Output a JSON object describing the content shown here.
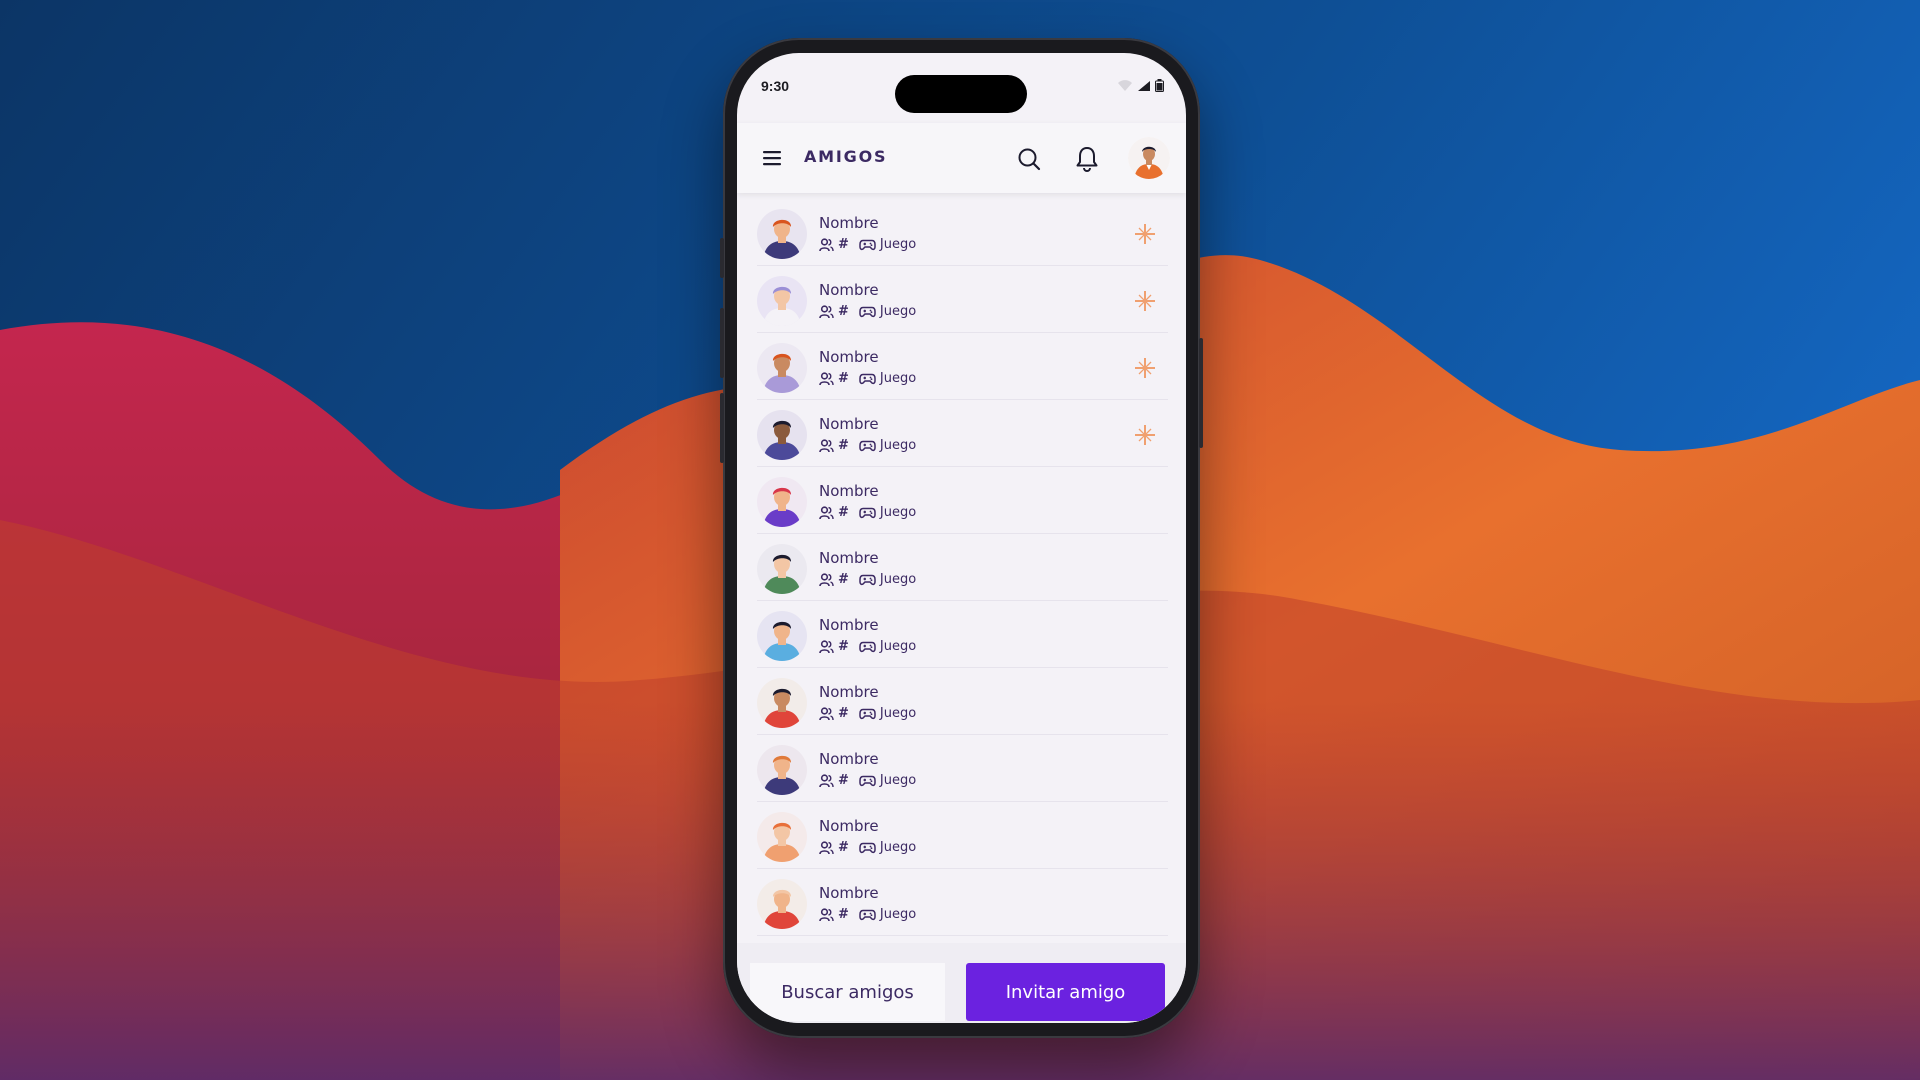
{
  "status_bar": {
    "time": "9:30"
  },
  "app_bar": {
    "title": "AMIGOS"
  },
  "friends": [
    {
      "name": "Nombre",
      "hash": "#",
      "game": "Juego",
      "favorite": true,
      "skin": "#f0b48a",
      "hair": "#d9541e",
      "shirt": "#3d3a7a",
      "bg": "#e8e4f0"
    },
    {
      "name": "Nombre",
      "hash": "#",
      "game": "Juego",
      "favorite": true,
      "skin": "#f3c6a5",
      "hair": "#9b8fd6",
      "shirt": "#f4f2f7",
      "bg": "#e9e4f4"
    },
    {
      "name": "Nombre",
      "hash": "#",
      "game": "Juego",
      "favorite": true,
      "skin": "#c98a61",
      "hair": "#d9541e",
      "shirt": "#a99ad8",
      "bg": "#ece8f2"
    },
    {
      "name": "Nombre",
      "hash": "#",
      "game": "Juego",
      "favorite": true,
      "skin": "#8b5a3c",
      "hair": "#1c1b2e",
      "shirt": "#4c4a9a",
      "bg": "#e6e2ef"
    },
    {
      "name": "Nombre",
      "hash": "#",
      "game": "Juego",
      "favorite": false,
      "skin": "#f0b48a",
      "hair": "#d8364a",
      "shirt": "#6a3cc8",
      "bg": "#f0e8f2"
    },
    {
      "name": "Nombre",
      "hash": "#",
      "game": "Juego",
      "favorite": false,
      "skin": "#f3c6a5",
      "hair": "#1c1b2e",
      "shirt": "#4f8a5a",
      "bg": "#ebe9f0"
    },
    {
      "name": "Nombre",
      "hash": "#",
      "game": "Juego",
      "favorite": false,
      "skin": "#f0b48a",
      "hair": "#1c1b2e",
      "shirt": "#5aaee0",
      "bg": "#e6e4f2"
    },
    {
      "name": "Nombre",
      "hash": "#",
      "game": "Juego",
      "favorite": false,
      "skin": "#c98a61",
      "hair": "#1c1b2e",
      "shirt": "#e0453a",
      "bg": "#f2ece9"
    },
    {
      "name": "Nombre",
      "hash": "#",
      "game": "Juego",
      "favorite": false,
      "skin": "#f0b48a",
      "hair": "#e07a3a",
      "shirt": "#3d3a7a",
      "bg": "#ede7ee"
    },
    {
      "name": "Nombre",
      "hash": "#",
      "game": "Juego",
      "favorite": false,
      "skin": "#f3c6a5",
      "hair": "#e8703a",
      "shirt": "#f0a070",
      "bg": "#f4eaea"
    },
    {
      "name": "Nombre",
      "hash": "#",
      "game": "Juego",
      "favorite": false,
      "skin": "#f0b48a",
      "hair": "#f3c6a5",
      "shirt": "#e0453a",
      "bg": "#f3ece8"
    }
  ],
  "actions": {
    "search_label": "Buscar amigos",
    "invite_label": "Invitar amigo"
  },
  "colors": {
    "accent": "#6b22e0",
    "text": "#3c2a63",
    "favorite": "#f0a070"
  },
  "icons": {
    "menu": "hamburger-menu-icon",
    "search": "search-icon",
    "notifications": "bell-icon",
    "friends": "people-icon",
    "game": "gamepad-icon",
    "favorite": "sparkle-star-icon"
  }
}
